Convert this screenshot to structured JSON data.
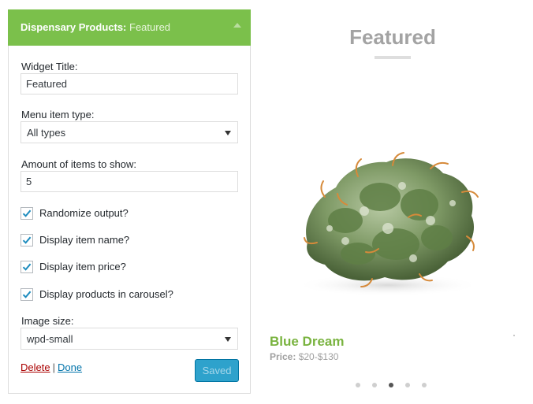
{
  "widget": {
    "header_title": "Dispensary Products",
    "header_title_suffix": "Featured",
    "widget_title_label": "Widget Title:",
    "widget_title_value": "Featured",
    "menu_item_type_label": "Menu item type:",
    "menu_item_type_value": "All types",
    "amount_label": "Amount of items to show:",
    "amount_value": "5",
    "checkboxes": [
      {
        "label": "Randomize output?",
        "checked": true
      },
      {
        "label": "Display item name?",
        "checked": true
      },
      {
        "label": "Display item price?",
        "checked": true
      },
      {
        "label": "Display products in carousel?",
        "checked": true
      }
    ],
    "image_size_label": "Image size:",
    "image_size_value": "wpd-small",
    "delete_label": "Delete",
    "separator": "|",
    "done_label": "Done",
    "saved_label": "Saved"
  },
  "preview": {
    "title": "Featured",
    "product": {
      "name": "Blue Dream",
      "price_label": "Price:",
      "price_value": "$20-$130"
    },
    "carousel_dots": 5,
    "active_dot": 3
  },
  "colors": {
    "header_green": "#7bc04b",
    "product_name_green": "#79b33f",
    "button_blue": "#2ea2cc",
    "link_blue": "#0073aa",
    "delete_red": "#aa0000",
    "checkmark_blue": "#1e8cbe"
  }
}
